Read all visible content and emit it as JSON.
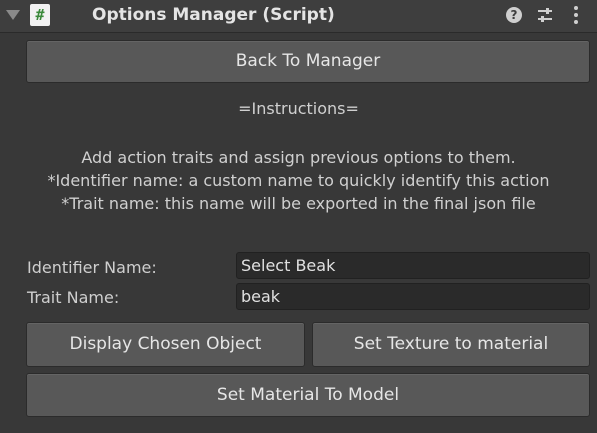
{
  "header": {
    "title": "Options Manager (Script)",
    "script_icon_glyph": "#",
    "help_glyph": "?",
    "icons": [
      "fold-arrow-icon",
      "script-icon",
      "help-icon",
      "settings-icon",
      "more-icon"
    ]
  },
  "buttons": {
    "back": "Back To Manager",
    "display_chosen": "Display Chosen Object",
    "set_texture": "Set Texture to material",
    "set_material": "Set Material To Model"
  },
  "instructions": {
    "heading": "=Instructions=",
    "lines": [
      "Add action traits and assign previous options to them.",
      "*Identifier name: a custom name to quickly identify this action",
      "*Trait name: this name will be exported in the final json file"
    ]
  },
  "fields": {
    "identifier": {
      "label": "Identifier Name:",
      "value": "Select Beak"
    },
    "trait": {
      "label": "Trait Name:",
      "value": "beak"
    }
  },
  "colors": {
    "background": "#383838",
    "header": "#3e3e3e",
    "button": "#585858",
    "field": "#2a2a2a",
    "script_icon_accent": "#3a8a3a"
  }
}
